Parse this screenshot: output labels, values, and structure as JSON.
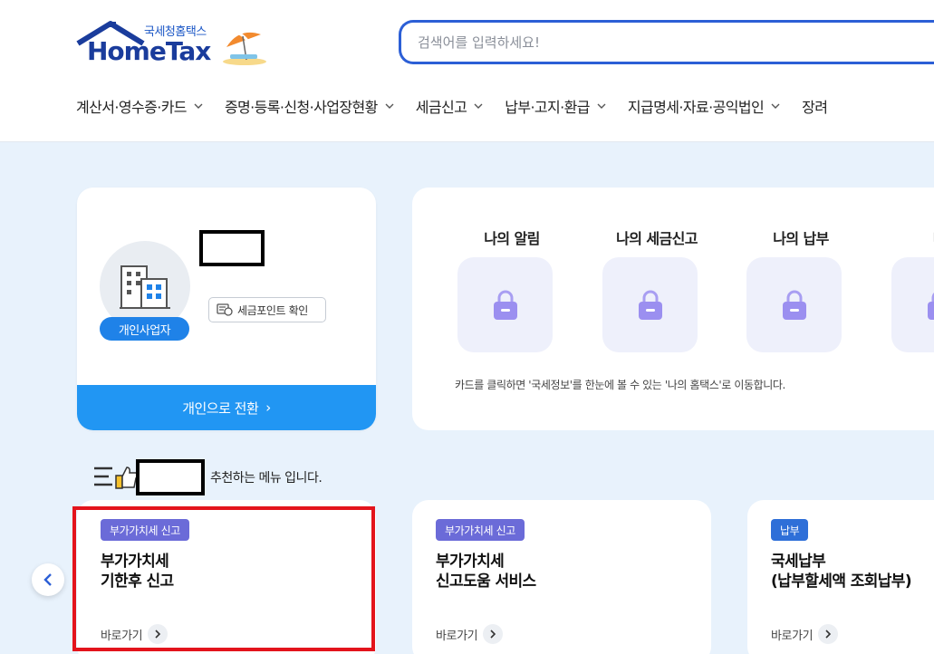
{
  "logo": {
    "sub_label": "국세청홈택스",
    "main_label": "HomeTax"
  },
  "search": {
    "placeholder": "검색어를 입력하세요!",
    "value": ""
  },
  "gnb": {
    "items": [
      {
        "label": "계산서·영수증·카드"
      },
      {
        "label": "증명·등록·신청·사업장현황"
      },
      {
        "label": "세금신고"
      },
      {
        "label": "납부·고지·환급"
      },
      {
        "label": "지급명세·자료·공익법인"
      },
      {
        "label": "장려"
      }
    ]
  },
  "profile": {
    "type_badge": "개인사업자",
    "point_button": "세금포인트 확인",
    "switch_button": "개인으로 전환",
    "switch_arrow": "›"
  },
  "my_hometax": {
    "items": [
      {
        "label": "나의 알림"
      },
      {
        "label": "나의 세금신고"
      },
      {
        "label": "나의 납부"
      },
      {
        "label": "나의"
      }
    ],
    "note": "카드를 클릭하면 '국세정보'를 한눈에 볼 수 있는 '나의 홈택스'로 이동합니다."
  },
  "recommend": {
    "text": "추천하는 메뉴 입니다."
  },
  "services": [
    {
      "badge": "부가가치세 신고",
      "title_line1": "부가가치세",
      "title_line2": "기한후 신고",
      "go": "바로가기",
      "badge_color": "#6b6bd8"
    },
    {
      "badge": "부가가치세 신고",
      "title_line1": "부가가치세",
      "title_line2": "신고도움 서비스",
      "go": "바로가기",
      "badge_color": "#6b6bd8"
    },
    {
      "badge": "납부",
      "title_line1": "국세납부",
      "title_line2": "(납부할세액 조회납부)",
      "go": "바로가기",
      "badge_color": "#2e6fd8"
    }
  ],
  "colors": {
    "brand_blue": "#2c5fd6",
    "switch_blue": "#2196f3",
    "highlight_red": "#e3141c",
    "lock_purple": "#9b8ff0"
  }
}
